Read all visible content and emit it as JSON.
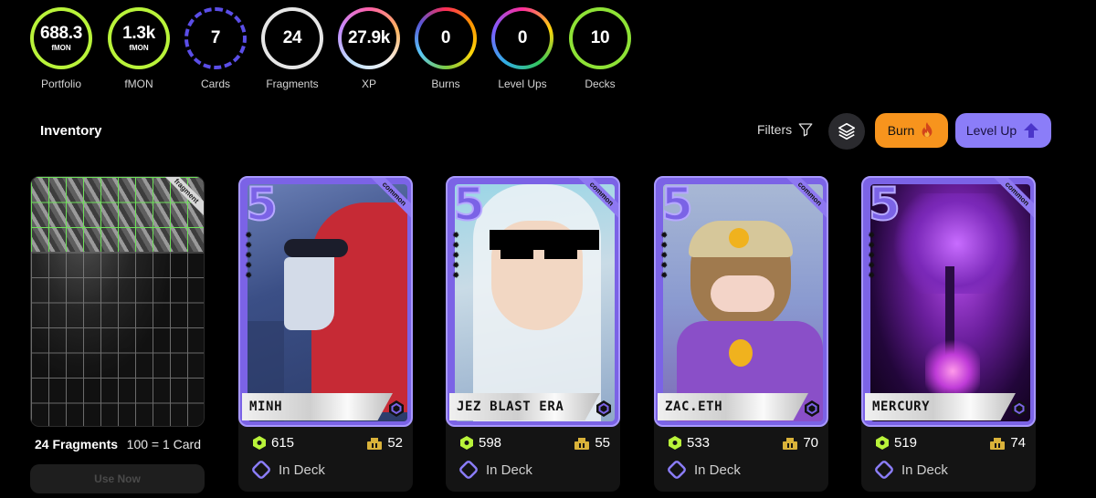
{
  "stats": [
    {
      "value": "688.3",
      "unit": "fMON",
      "label": "Portfolio"
    },
    {
      "value": "1.3k",
      "unit": "fMON",
      "label": "fMON"
    },
    {
      "value": "7",
      "unit": "",
      "label": "Cards"
    },
    {
      "value": "24",
      "unit": "",
      "label": "Fragments"
    },
    {
      "value": "27.9k",
      "unit": "",
      "label": "XP"
    },
    {
      "value": "0",
      "unit": "",
      "label": "Burns"
    },
    {
      "value": "0",
      "unit": "",
      "label": "Level Ups"
    },
    {
      "value": "10",
      "unit": "",
      "label": "Decks"
    }
  ],
  "inventory": {
    "title": "Inventory",
    "filters_label": "Filters",
    "burn_label": "Burn",
    "level_up_label": "Level Up"
  },
  "fragments_card": {
    "tag": "fragment",
    "count_label": "24 Fragments",
    "rate_label": "100 = 1 Card",
    "use_now_label": "Use Now"
  },
  "cards": [
    {
      "name": "MINH",
      "level": "5",
      "rarity": "common",
      "hex_value": "615",
      "bag_value": "52",
      "deck_status": "In Deck"
    },
    {
      "name": "JEZ BLAST ERA",
      "level": "5",
      "rarity": "common",
      "hex_value": "598",
      "bag_value": "55",
      "deck_status": "In Deck"
    },
    {
      "name": "ZAC.ETH",
      "level": "5",
      "rarity": "common",
      "hex_value": "533",
      "bag_value": "70",
      "deck_status": "In Deck"
    },
    {
      "name": "MERCURY",
      "level": "5",
      "rarity": "common",
      "hex_value": "519",
      "bag_value": "74",
      "deck_status": "In Deck"
    }
  ],
  "colors": {
    "accent_purple": "#7b63e6",
    "burn_orange": "#f7941d",
    "level_up_purple": "#8b7df8",
    "hex_green": "#b9f33a",
    "bag_gold": "#d9b23a"
  }
}
